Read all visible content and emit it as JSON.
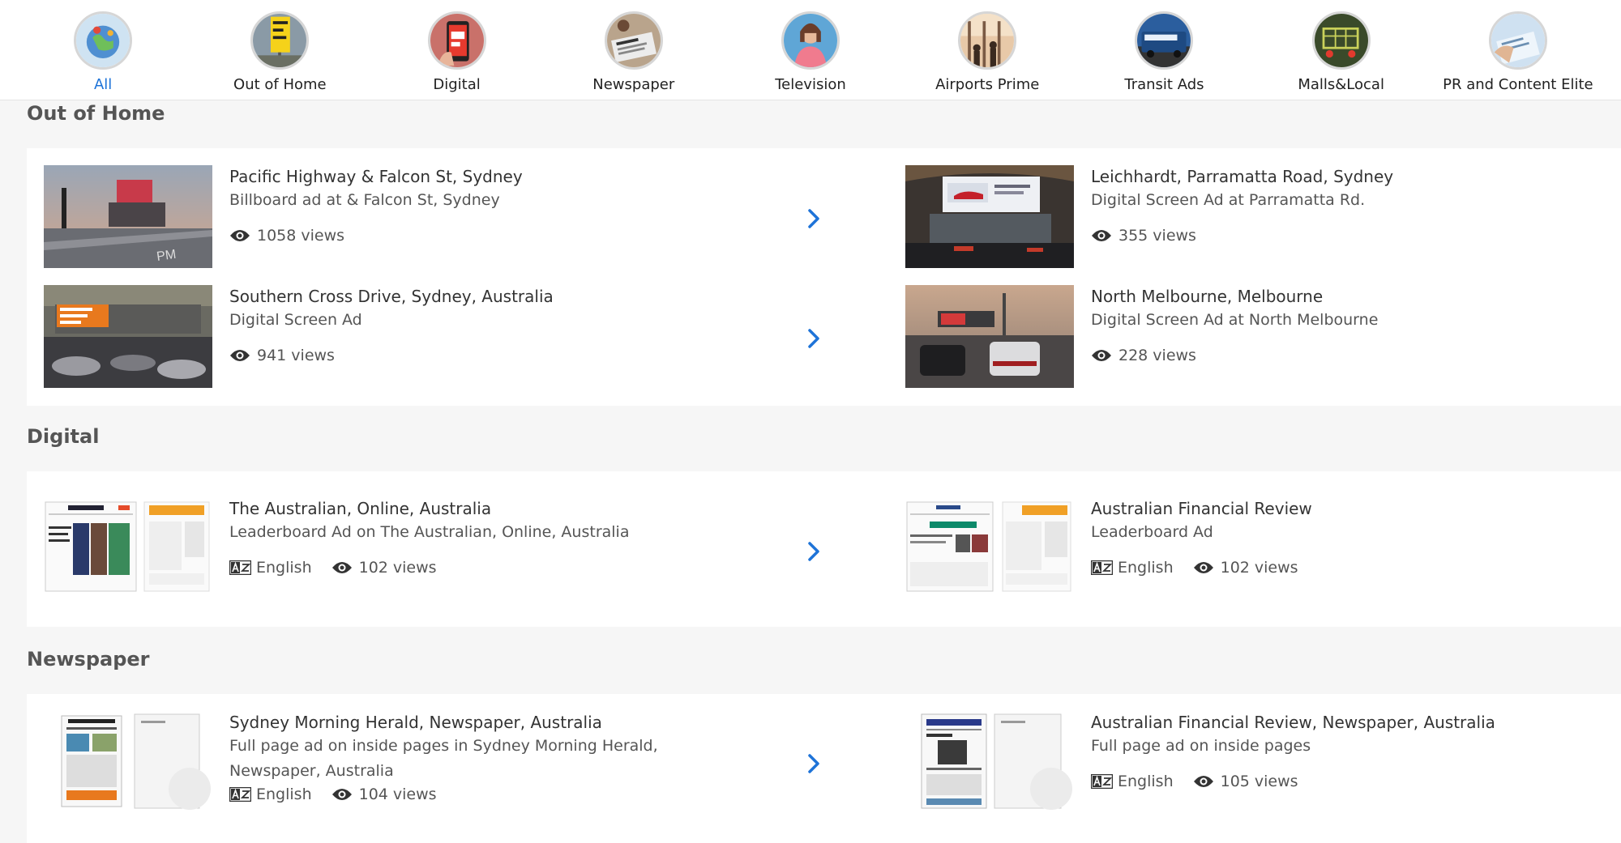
{
  "categories": [
    {
      "label": "All",
      "icon": "globe-icon",
      "active": true
    },
    {
      "label": "Out of Home",
      "icon": "billboard-icon"
    },
    {
      "label": "Digital",
      "icon": "phone-icon"
    },
    {
      "label": "Newspaper",
      "icon": "newspaper-icon"
    },
    {
      "label": "Television",
      "icon": "television-icon"
    },
    {
      "label": "Airports Prime",
      "icon": "airport-icon"
    },
    {
      "label": "Transit Ads",
      "icon": "bus-icon"
    },
    {
      "label": "Malls&Local",
      "icon": "shopping-cart-icon"
    },
    {
      "label": "PR and Content Elite",
      "icon": "pr-icon"
    }
  ],
  "sections": {
    "ooh": {
      "title": "Out of Home",
      "items": [
        {
          "title": "Pacific Highway & Falcon St, Sydney",
          "subtitle": "Billboard ad at & Falcon St, Sydney",
          "views": "1058 views"
        },
        {
          "title": "Leichhardt, Parramatta Road, Sydney",
          "subtitle": "Digital Screen Ad at Parramatta Rd.",
          "views": "355 views"
        },
        {
          "title": "Southern Cross Drive, Sydney, Australia",
          "subtitle": "Digital Screen Ad",
          "views": "941 views"
        },
        {
          "title": "North Melbourne, Melbourne",
          "subtitle": "Digital Screen Ad at North Melbourne",
          "views": "228 views"
        }
      ]
    },
    "digital": {
      "title": "Digital",
      "items": [
        {
          "title": "The Australian, Online, Australia",
          "subtitle": "Leaderboard Ad on The Australian, Online, Australia",
          "language": "English",
          "views": "102 views"
        },
        {
          "title": "Australian Financial Review",
          "subtitle": "Leaderboard Ad",
          "language": "English",
          "views": "102 views"
        }
      ]
    },
    "newspaper": {
      "title": "Newspaper",
      "items": [
        {
          "title": "Sydney Morning Herald, Newspaper, Australia",
          "subtitle": "Full page ad on inside pages in Sydney Morning Herald, Newspaper, Australia",
          "language": "English",
          "views": "104 views"
        },
        {
          "title": "Australian Financial Review, Newspaper, Australia",
          "subtitle": "Full page ad on inside pages",
          "language": "English",
          "views": "105 views"
        }
      ]
    }
  },
  "colors": {
    "accent": "#1e73d8",
    "text": "#333333"
  }
}
